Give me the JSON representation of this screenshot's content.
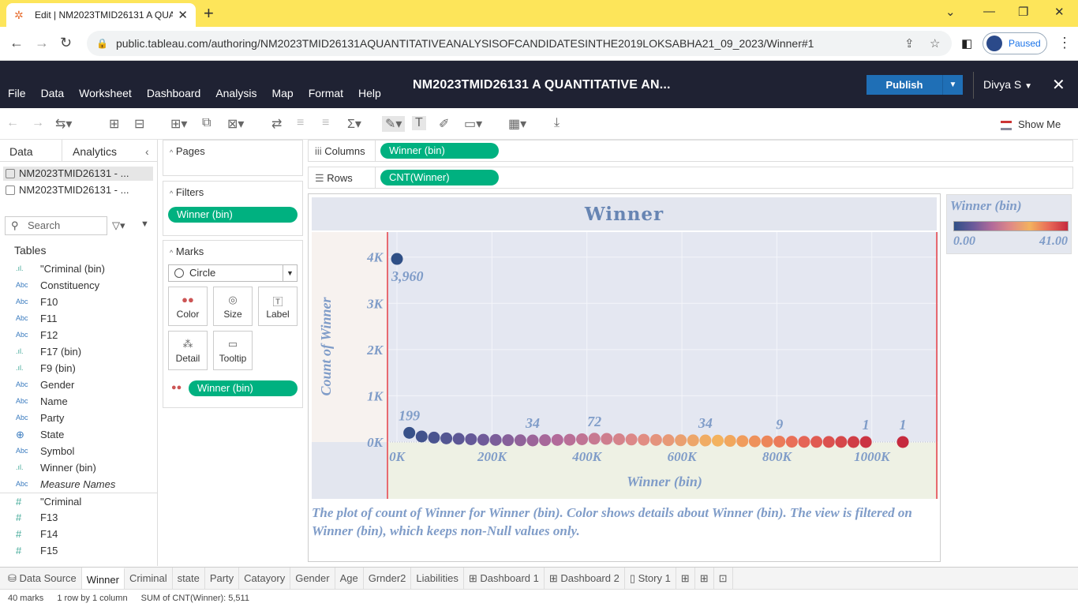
{
  "browser": {
    "tab_title": "Edit | NM2023TMID26131 A QUA",
    "url": "public.tableau.com/authoring/NM2023TMID26131AQUANTITATIVEANALYSISOFCANDIDATESINTHE2019LOKSABHA21_09_2023/Winner#1",
    "profile_status": "Paused"
  },
  "tableau": {
    "menu": [
      "File",
      "Data",
      "Worksheet",
      "Dashboard",
      "Analysis",
      "Map",
      "Format",
      "Help"
    ],
    "workbook_title": "NM2023TMID26131 A QUANTITATIVE AN...",
    "publish_label": "Publish",
    "user_name": "Divya S",
    "show_me_label": "Show Me"
  },
  "data_pane": {
    "tabs": [
      "Data",
      "Analytics"
    ],
    "datasources": [
      "NM2023TMID26131 - ...",
      "NM2023TMID26131 - ..."
    ],
    "search_placeholder": "Search",
    "tables_label": "Tables",
    "fields": [
      {
        "icon": "bin",
        "type": ".ıl.",
        "name": "\"Criminal (bin)"
      },
      {
        "icon": "text",
        "type": "Abc",
        "name": "Constituency"
      },
      {
        "icon": "text",
        "type": "Abc",
        "name": "F10"
      },
      {
        "icon": "text",
        "type": "Abc",
        "name": "F11"
      },
      {
        "icon": "text",
        "type": "Abc",
        "name": "F12"
      },
      {
        "icon": "bin",
        "type": ".ıl.",
        "name": "F17 (bin)"
      },
      {
        "icon": "bin",
        "type": ".ıl.",
        "name": "F9 (bin)"
      },
      {
        "icon": "text",
        "type": "Abc",
        "name": "Gender"
      },
      {
        "icon": "text",
        "type": "Abc",
        "name": "Name"
      },
      {
        "icon": "text",
        "type": "Abc",
        "name": "Party"
      },
      {
        "icon": "globe",
        "type": "⊕",
        "name": "State"
      },
      {
        "icon": "text",
        "type": "Abc",
        "name": "Symbol"
      },
      {
        "icon": "bin",
        "type": ".ıl.",
        "name": "Winner (bin)"
      },
      {
        "icon": "text",
        "type": "Abc",
        "name": "Measure Names"
      },
      {
        "icon": "number",
        "type": "#",
        "name": "\"Criminal"
      },
      {
        "icon": "number",
        "type": "#",
        "name": "F13"
      },
      {
        "icon": "number",
        "type": "#",
        "name": "F14"
      },
      {
        "icon": "number",
        "type": "#",
        "name": "F15"
      }
    ]
  },
  "cards": {
    "pages_label": "Pages",
    "filters_label": "Filters",
    "filter_pill": "Winner (bin)",
    "marks_label": "Marks",
    "mark_type": "Circle",
    "mark_buttons": [
      "Color",
      "Size",
      "Label",
      "Detail",
      "Tooltip"
    ],
    "color_pill": "Winner (bin)"
  },
  "shelves": {
    "columns_label": "Columns",
    "columns_pill": "Winner (bin)",
    "rows_label": "Rows",
    "rows_pill": "CNT(Winner)"
  },
  "viz": {
    "title": "Winner",
    "caption": "The plot of count of Winner for Winner (bin).  Color shows details about Winner (bin). The view is filtered on Winner (bin), which keeps non-Null values only."
  },
  "chart_data": {
    "type": "scatter",
    "title": "Winner",
    "xlabel": "Winner (bin)",
    "ylabel": "Count of Winner",
    "x_ticks": [
      "0K",
      "200K",
      "400K",
      "600K",
      "800K",
      "1000K"
    ],
    "y_ticks": [
      "0K",
      "1K",
      "2K",
      "3K",
      "4K"
    ],
    "xlim": [
      -20000,
      1140000
    ],
    "ylim": [
      0,
      4200
    ],
    "grid": true,
    "x": [
      0,
      25982,
      51964,
      77946,
      103928,
      129910,
      155892,
      181874,
      207856,
      233838,
      259820,
      285802,
      311784,
      337766,
      363748,
      389730,
      415712,
      441694,
      467676,
      493658,
      519640,
      545622,
      571604,
      597586,
      623568,
      649550,
      675532,
      701514,
      727496,
      753478,
      779460,
      805442,
      831424,
      857406,
      883388,
      909370,
      935352,
      961334,
      987316,
      1065262
    ],
    "values": [
      3960,
      199,
      120,
      95,
      80,
      70,
      60,
      50,
      45,
      40,
      38,
      34,
      40,
      45,
      50,
      60,
      72,
      68,
      60,
      55,
      50,
      45,
      40,
      38,
      36,
      34,
      30,
      25,
      20,
      15,
      12,
      9,
      7,
      5,
      4,
      3,
      2,
      1,
      1,
      1
    ],
    "data_labels": [
      {
        "index": 0,
        "text": "3,960"
      },
      {
        "index": 1,
        "text": "199"
      },
      {
        "index": 11,
        "text": "34"
      },
      {
        "index": 16,
        "text": "72"
      },
      {
        "index": 25,
        "text": "34"
      },
      {
        "index": 31,
        "text": "9"
      },
      {
        "index": 38,
        "text": "1"
      },
      {
        "index": 39,
        "text": "1"
      }
    ],
    "legend": {
      "title": "Winner (bin)",
      "min": "0.00",
      "max": "41.00",
      "placement": "top-right"
    },
    "color_scale": [
      "#2f4f86",
      "#6a5a9a",
      "#b26a9a",
      "#e08a86",
      "#f3b25e",
      "#e86a58",
      "#c62a3e"
    ]
  },
  "sheet_tabs": [
    "Data Source",
    "Winner",
    "Criminal",
    "state",
    "Party",
    "Catayory",
    "Gender",
    "Age",
    "Grnder2",
    "Liabilities",
    "Dashboard 1",
    "Dashboard 2",
    "Story 1"
  ],
  "active_sheet": "Winner",
  "status": {
    "marks": "40 marks",
    "dims": "1 row by 1 column",
    "sum": "SUM of CNT(Winner): 5,511"
  }
}
